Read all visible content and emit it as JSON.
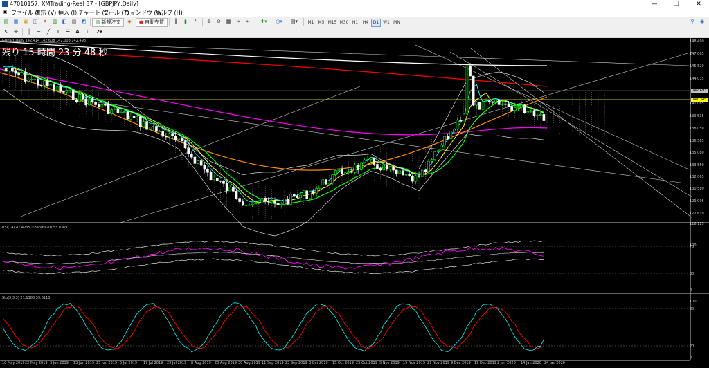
{
  "window": {
    "title": "47010157: XMTrading-Real 37 - [GBPJPY,Daily]",
    "controls": [
      "—",
      "❐",
      "✕"
    ]
  },
  "menu": [
    "ファイル (F)",
    "表示 (V)",
    "挿入 (I)",
    "チャート (C)",
    "ツール (T)",
    "ウィンドウ (W)",
    "ヘルプ (H)"
  ],
  "toolbar": {
    "new_order": "新規注文",
    "auto_trade": "自動売買",
    "timeframes": [
      "M1",
      "M5",
      "M15",
      "M30",
      "H1",
      "H4",
      "D1",
      "W1",
      "MN"
    ],
    "active_timeframe": "D1",
    "draw_text": "A",
    "draw_label": "T"
  },
  "chart": {
    "symbol_header": "GBPJPY,Daily  142.414 142.608 142.003 142.493",
    "countdown": "残り 15 時間 23 分 48 秒",
    "current_price": "142.493",
    "line_price": "141.345",
    "price_axis": [
      "148.490",
      "147.005",
      "145.520",
      "144.035",
      "141.065",
      "139.535",
      "138.050",
      "136.565",
      "135.080",
      "133.550",
      "132.065",
      "130.580",
      "129.095",
      "127.610",
      "126.125"
    ],
    "dates": [
      "10 May 2019",
      "22 May 2019",
      "3 Jun 2019",
      "13 Jun 2019",
      "25 Jun 2019",
      "5 Jul 2019",
      "17 Jul 2019",
      "29 Jul 2019",
      "8 Aug 2019",
      "20 Aug 2019",
      "30 Aug 2019",
      "11 Sep 2019",
      "23 Sep 2019",
      "3 Oct 2019",
      "15 Oct 2019",
      "25 Oct 2019",
      "5 Nov 2019",
      "15 Nov 2019",
      "27 Nov 2019",
      "9 Dec 2019",
      "19 Dec 2019",
      "2 Jan 2020",
      "14 Jan 2020",
      "24 Jan 2020"
    ]
  },
  "rsi_panel": {
    "header": "RSI(14) 47.4235  ∞Bands(20) 53.0369",
    "levels": [
      "70",
      "30"
    ],
    "axis": [
      "100",
      "0"
    ]
  },
  "stoch_panel": {
    "header": "Sto(5,3,3) 21.1388 39.0113",
    "levels": [
      "80",
      "20"
    ],
    "axis": [
      "100",
      "0"
    ]
  },
  "colors": {
    "background": "#000000",
    "bull_candle": "#00ff00",
    "bear_candle": "#ffffff",
    "ma_red": "#ff0000",
    "ma_magenta": "#ff00ff",
    "ma_orange": "#ff8c00",
    "ma_yellow": "#ffff00",
    "ma_green": "#00ff00",
    "ma_cyan": "#00ffff",
    "price_box": "#c0c0c0",
    "line_box": "#ffff00"
  }
}
